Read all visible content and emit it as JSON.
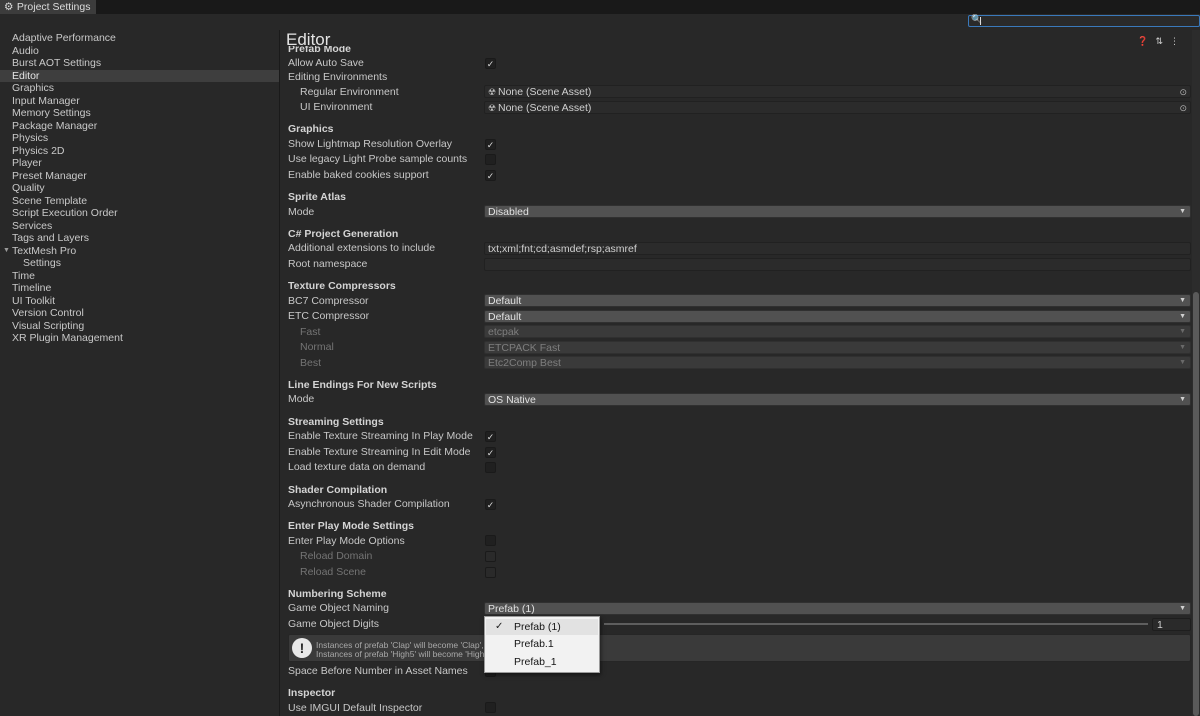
{
  "window": {
    "tab_title": "Project Settings"
  },
  "search": {
    "value": ""
  },
  "sidebar": {
    "items": [
      "Adaptive Performance",
      "Audio",
      "Burst AOT Settings",
      "Editor",
      "Graphics",
      "Input Manager",
      "Memory Settings",
      "Package Manager",
      "Physics",
      "Physics 2D",
      "Player",
      "Preset Manager",
      "Quality",
      "Scene Template",
      "Script Execution Order",
      "Services",
      "Tags and Layers",
      "TextMesh Pro",
      "Settings",
      "Time",
      "Timeline",
      "UI Toolkit",
      "Version Control",
      "Visual Scripting",
      "XR Plugin Management"
    ],
    "selected": "Editor"
  },
  "main": {
    "title": "Editor",
    "prefab_mode": {
      "header": "Prefab Mode",
      "allow_auto_save": "Allow Auto Save",
      "editing_environments": "Editing Environments",
      "regular_environment": "Regular Environment",
      "regular_environment_value": "None (Scene Asset)",
      "ui_environment": "UI Environment",
      "ui_environment_value": "None (Scene Asset)"
    },
    "graphics": {
      "header": "Graphics",
      "show_lightmap": "Show Lightmap Resolution Overlay",
      "legacy_light_probe": "Use legacy Light Probe sample counts",
      "baked_cookies": "Enable baked cookies support"
    },
    "sprite_atlas": {
      "header": "Sprite Atlas",
      "mode": "Mode",
      "mode_value": "Disabled"
    },
    "csharp": {
      "header": "C# Project Generation",
      "extensions": "Additional extensions to include",
      "extensions_value": "txt;xml;fnt;cd;asmdef;rsp;asmref",
      "root_namespace": "Root namespace",
      "root_namespace_value": ""
    },
    "texture_compressors": {
      "header": "Texture Compressors",
      "bc7": "BC7 Compressor",
      "bc7_value": "Default",
      "etc": "ETC Compressor",
      "etc_value": "Default",
      "fast": "Fast",
      "fast_value": "etcpak",
      "normal": "Normal",
      "normal_value": "ETCPACK Fast",
      "best": "Best",
      "best_value": "Etc2Comp Best"
    },
    "line_endings": {
      "header": "Line Endings For New Scripts",
      "mode": "Mode",
      "mode_value": "OS Native"
    },
    "streaming": {
      "header": "Streaming Settings",
      "play_mode": "Enable Texture Streaming In Play Mode",
      "edit_mode": "Enable Texture Streaming In Edit Mode",
      "on_demand": "Load texture data on demand"
    },
    "shader": {
      "header": "Shader Compilation",
      "async": "Asynchronous Shader Compilation"
    },
    "play_mode": {
      "header": "Enter Play Mode Settings",
      "options": "Enter Play Mode Options",
      "reload_domain": "Reload Domain",
      "reload_scene": "Reload Scene"
    },
    "numbering": {
      "header": "Numbering Scheme",
      "naming": "Game Object Naming",
      "naming_value": "Prefab (1)",
      "digits": "Game Object Digits",
      "digits_value": "1",
      "help_line1": "Instances of prefab 'Clap' will become 'Clap', '",
      "help_line2": "Instances of prefab 'High5' will become 'High5",
      "space_before": "Space Before Number in Asset Names"
    },
    "inspector": {
      "header": "Inspector",
      "imgui": "Use IMGUI Default Inspector"
    }
  },
  "popup": {
    "options": [
      "Prefab (1)",
      "Prefab.1",
      "Prefab_1"
    ],
    "selected": "Prefab (1)",
    "check_glyph": "✓"
  },
  "colors": {
    "accent": "#3a79bb",
    "background": "#282828",
    "selection": "#3e3e3e"
  }
}
